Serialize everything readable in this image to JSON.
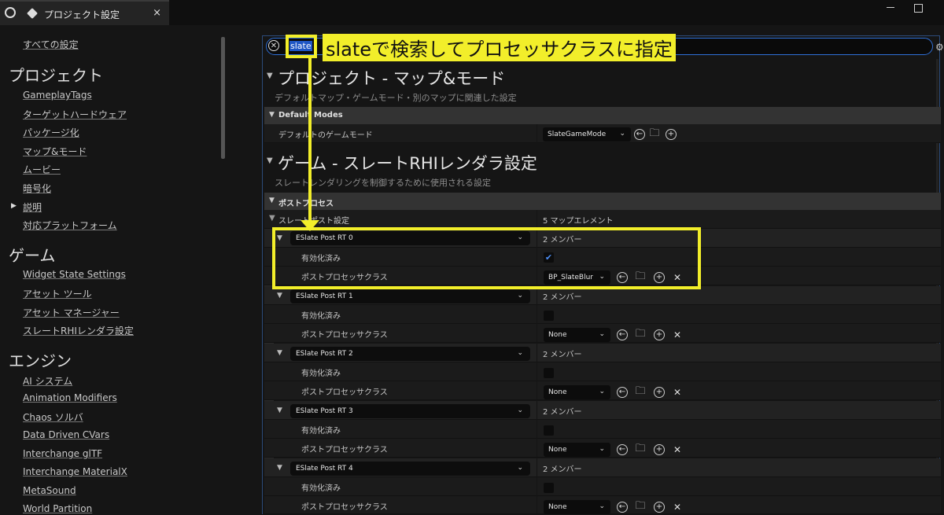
{
  "tab": {
    "title": "プロジェクト設定",
    "close": "×"
  },
  "sidebar": {
    "all_settings": "すべての設定",
    "headings": {
      "project": "プロジェクト",
      "game": "ゲーム",
      "engine": "エンジン"
    },
    "project_items": [
      "GameplayTags",
      "ターゲットハードウェア",
      "パッケージ化",
      "マップ&モード",
      "ムービー",
      "暗号化",
      "説明",
      "対応プラットフォーム"
    ],
    "game_items": [
      "Widget State Settings",
      "アセット ツール",
      "アセット マネージャー",
      "スレートRHIレンダラ設定"
    ],
    "engine_items": [
      "AI システム",
      "Animation Modifiers",
      "Chaos ソルバ",
      "Data Driven CVars",
      "Interchange glTF",
      "Interchange MaterialX",
      "MetaSound",
      "World Partition"
    ]
  },
  "search": {
    "value": "slate"
  },
  "annotation": {
    "text": "slateで検索してプロセッサクラスに指定"
  },
  "sections": {
    "maps": {
      "title": "プロジェクト - マップ&モード",
      "desc": "デフォルトマップ・ゲームモード・別のマップに関連した設定",
      "category": "Default Modes",
      "row_label": "デフォルトのゲームモード",
      "row_value": "SlateGameMode"
    },
    "slate": {
      "title": "ゲーム - スレートRHIレンダラ設定",
      "desc": "スレートレンダリングを制御するために使用される設定",
      "category": "ポストプロセス",
      "row_label": "スレートポスト設定",
      "row_value": "5 マップエレメント"
    }
  },
  "elements": [
    {
      "key": "ESlate Post RT 0",
      "members": "2 メンバー",
      "enabled_label": "有効化済み",
      "enabled": true,
      "processor_label": "ポストプロセッサクラス",
      "processor_value": "BP_SlateBlur"
    },
    {
      "key": "ESlate Post RT 1",
      "members": "2 メンバー",
      "enabled_label": "有効化済み",
      "enabled": false,
      "processor_label": "ポストプロセッサクラス",
      "processor_value": "None"
    },
    {
      "key": "ESlate Post RT 2",
      "members": "2 メンバー",
      "enabled_label": "有効化済み",
      "enabled": false,
      "processor_label": "ポストプロセッサクラス",
      "processor_value": "None"
    },
    {
      "key": "ESlate Post RT 3",
      "members": "2 メンバー",
      "enabled_label": "有効化済み",
      "enabled": false,
      "processor_label": "ポストプロセッサクラス",
      "processor_value": "None"
    },
    {
      "key": "ESlate Post RT 4",
      "members": "2 メンバー",
      "enabled_label": "有効化済み",
      "enabled": false,
      "processor_label": "ポストプロセッサクラス",
      "processor_value": "None"
    }
  ],
  "icons": {
    "use_selected": "arrow-left-circle-icon",
    "browse": "folder-search-icon",
    "add": "plus-circle-icon",
    "clear": "x-icon"
  },
  "colors": {
    "highlight": "#f2ee2a",
    "search_selection": "#1f56c4",
    "checkbox": "#4c8ef5"
  }
}
